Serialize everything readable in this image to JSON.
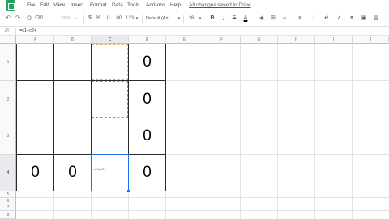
{
  "menu": {
    "items": [
      "File",
      "Edit",
      "View",
      "Insert",
      "Format",
      "Data",
      "Tools",
      "Add-ons",
      "Help"
    ],
    "saved_status": "All changes saved in Drive"
  },
  "toolbar": {
    "zoom": "100%",
    "currency": "$",
    "percent": "%",
    "decimal_decrease": ".0",
    "decimal_increase": ".00",
    "more_formats": "123",
    "font": "Default (Ari...",
    "font_size": "26",
    "bold": "B",
    "italic": "I",
    "strikethrough": "S",
    "text_color": "A"
  },
  "formula_bar": {
    "fx": "fx",
    "value": "=c1+c2+"
  },
  "grid": {
    "columns": [
      "A",
      "B",
      "C",
      "D",
      "E",
      "F",
      "G",
      "H",
      "I",
      "J"
    ],
    "rows": [
      "1",
      "2",
      "3",
      "4",
      "5",
      "6",
      "7",
      "8"
    ],
    "selected_column": "C",
    "selected_row": "4",
    "cells": {
      "D1": "0",
      "D2": "0",
      "D3": "0",
      "A4": "0",
      "B4": "0",
      "C4": "=c1+c2+",
      "D4": "0"
    }
  }
}
